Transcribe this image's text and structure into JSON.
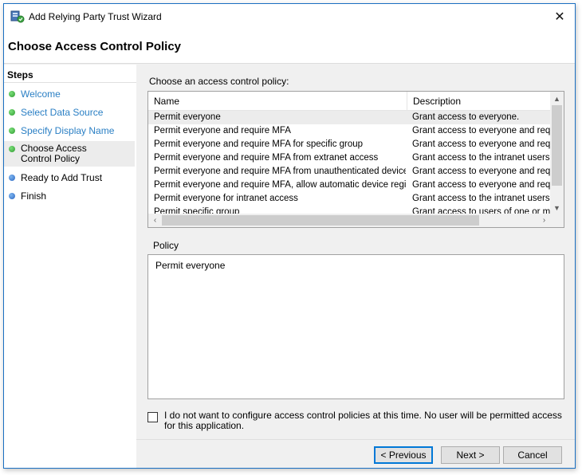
{
  "window": {
    "title": "Add Relying Party Trust Wizard",
    "close_glyph": "✕"
  },
  "header": {
    "page_title": "Choose Access Control Policy"
  },
  "steps": {
    "title": "Steps",
    "items": [
      {
        "label": "Welcome",
        "status": "done"
      },
      {
        "label": "Select Data Source",
        "status": "done"
      },
      {
        "label": "Specify Display Name",
        "status": "done"
      },
      {
        "label": "Choose Access Control Policy",
        "status": "current"
      },
      {
        "label": "Ready to Add Trust",
        "status": "pending"
      },
      {
        "label": "Finish",
        "status": "pending"
      }
    ]
  },
  "policy_list": {
    "prompt": "Choose an access control policy:",
    "columns": [
      "Name",
      "Description"
    ],
    "rows": [
      {
        "name": "Permit everyone",
        "description": "Grant access to everyone."
      },
      {
        "name": "Permit everyone and require MFA",
        "description": "Grant access to everyone and requir"
      },
      {
        "name": "Permit everyone and require MFA for specific group",
        "description": "Grant access to everyone and requir"
      },
      {
        "name": "Permit everyone and require MFA from extranet access",
        "description": "Grant access to the intranet users ar"
      },
      {
        "name": "Permit everyone and require MFA from unauthenticated devices",
        "description": "Grant access to everyone and requir"
      },
      {
        "name": "Permit everyone and require MFA, allow automatic device registr...",
        "description": "Grant access to everyone and requir"
      },
      {
        "name": "Permit everyone for intranet access",
        "description": "Grant access to the intranet users."
      },
      {
        "name": "Permit specific group",
        "description": "Grant access to users of one or more"
      }
    ],
    "selected_index": 0
  },
  "policy": {
    "label": "Policy",
    "value": "Permit everyone"
  },
  "optout": {
    "checked": false,
    "text": "I do not want to configure access control policies at this time. No user will be permitted access for this application."
  },
  "buttons": {
    "previous": "< Previous",
    "next": "Next >",
    "cancel": "Cancel"
  },
  "colors": {
    "accent": "#0078d7",
    "link": "#2a7fc4",
    "step_done": "#2f9a2f",
    "step_pending": "#2b66c2"
  }
}
